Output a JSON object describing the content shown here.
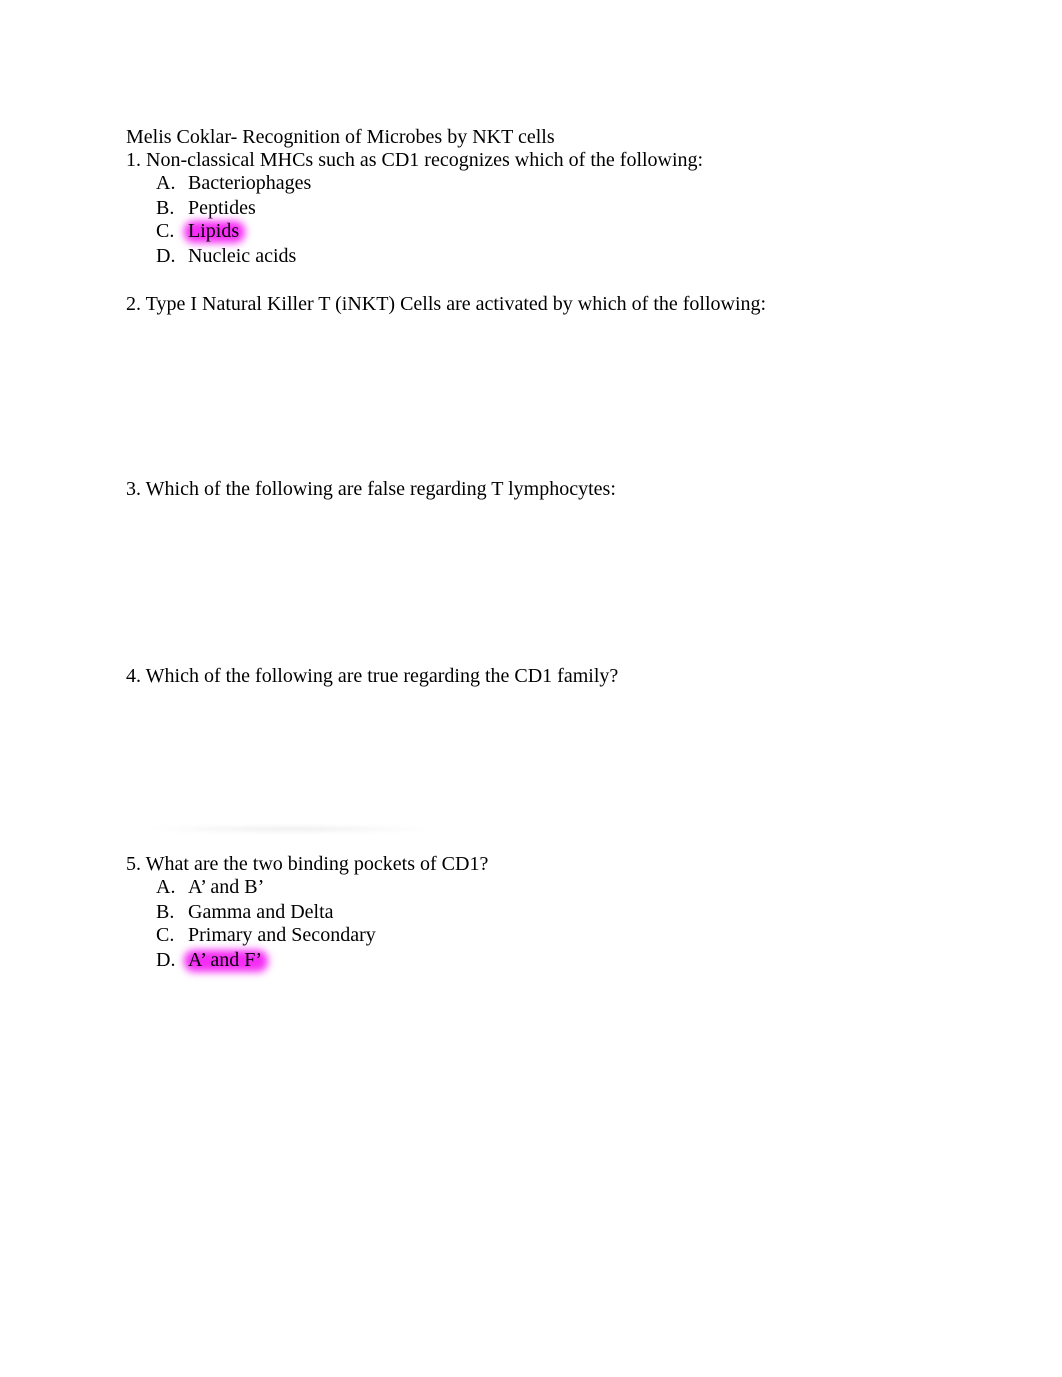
{
  "title": "Melis Coklar- Recognition of Microbes by NKT cells",
  "questions": [
    {
      "text": "1. Non-classical MHCs such as CD1 recognizes which of the following:",
      "options": [
        {
          "letter": "A.",
          "text": "Bacteriophages",
          "highlighted": false
        },
        {
          "letter": "B.",
          "text": "Peptides",
          "highlighted": false
        },
        {
          "letter": "C.",
          "text": "Lipids",
          "highlighted": true
        },
        {
          "letter": "D.",
          "text": "Nucleic acids",
          "highlighted": false
        }
      ]
    },
    {
      "text": "2. Type I Natural Killer T (iNKT) Cells are activated by which of the following:",
      "options": []
    },
    {
      "text": "3. Which of the following are false regarding T lymphocytes:",
      "options": []
    },
    {
      "text": "4. Which of the following are true regarding the CD1 family?",
      "options": []
    },
    {
      "text": "5. What are the two binding pockets of CD1?",
      "options": [
        {
          "letter": "A.",
          "text": "A’ and B’",
          "highlighted": false
        },
        {
          "letter": "B.",
          "text": "Gamma and Delta",
          "highlighted": false
        },
        {
          "letter": "C.",
          "text": "Primary and Secondary",
          "highlighted": false
        },
        {
          "letter": "D.",
          "text": "A’ and F’",
          "highlighted": true
        }
      ]
    }
  ],
  "highlight_color": "#f52cf5"
}
